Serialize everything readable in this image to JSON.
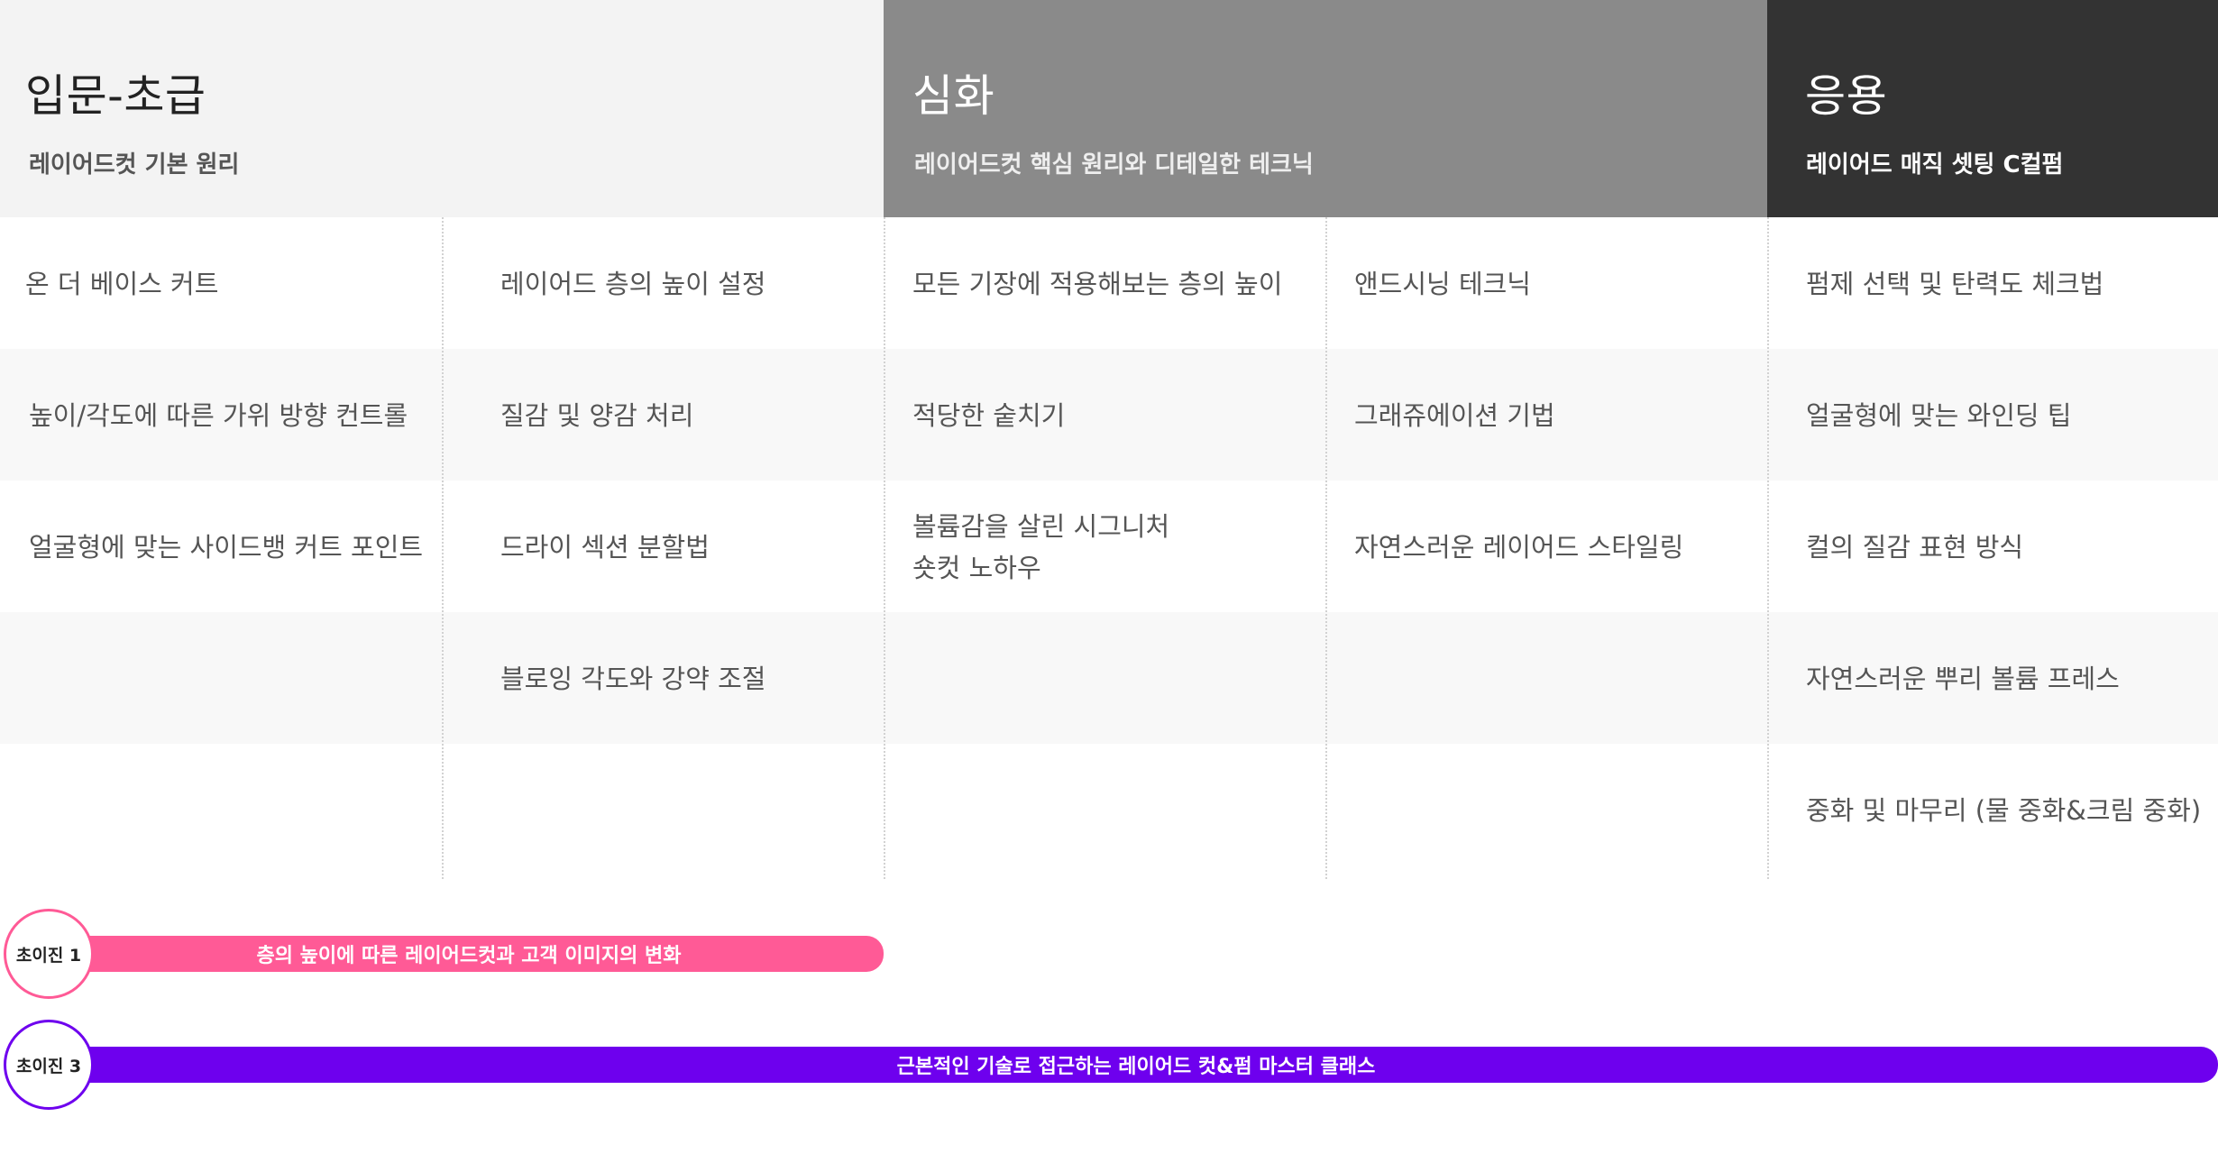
{
  "stages": [
    {
      "title": "입문-초급",
      "subtitle": "레이어드컷 기본 원리"
    },
    {
      "title": "심화",
      "subtitle": "레이어드컷 핵심 원리와 디테일한 테크닉"
    },
    {
      "title": "응용",
      "subtitle": "레이어드 매직 셋팅 C컬펌"
    }
  ],
  "columns": [
    [
      "온 더 베이스 커트",
      "높이/각도에 따른 가위 방향 컨트롤",
      "얼굴형에 맞는 사이드뱅 커트 포인트"
    ],
    [
      "레이어드 층의 높이 설정",
      "질감 및 양감 처리",
      "드라이 섹션 분할법",
      "블로잉 각도와 강약 조절"
    ],
    [
      "모든 기장에 적용해보는 층의 높이",
      "적당한 숱치기",
      "볼륨감을 살린 시그니처\n숏컷 노하우"
    ],
    [
      "앤드시닝 테크닉",
      "그래쥬에이션 기법",
      "자연스러운 레이어드 스타일링"
    ],
    [
      "펌제 선택 및 탄력도 체크법",
      "얼굴형에 맞는 와인딩 팁",
      "컬의 질감 표현 방식",
      "자연스러운 뿌리 볼륨 프레스",
      "중화 및 마무리 (물 중화&크림 중화)"
    ]
  ],
  "courses": [
    {
      "label": "초이진 1",
      "title": "층의 높이에 따른 레이어드컷과 고객 이미지의 변화",
      "color": "#ff5a96"
    },
    {
      "label": "초이진 3",
      "title": "근본적인 기술로 접근하는 레이어드 컷&펌 마스터 클래스",
      "color": "#6e00ee"
    }
  ]
}
